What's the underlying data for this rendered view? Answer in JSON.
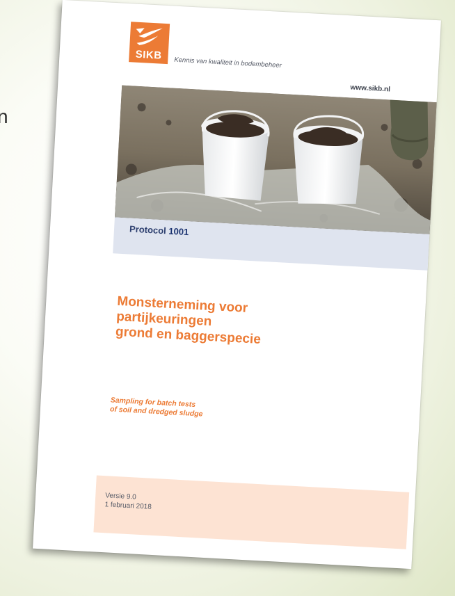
{
  "background": {
    "edge_letter": "n"
  },
  "document": {
    "logo": {
      "text": "SIKB",
      "icon": "sikb-bird-logo",
      "color": "#ec7b35"
    },
    "tagline": "Kennis van kwaliteit in bodembeheer",
    "website": "www.sikb.nl",
    "photo": {
      "icon": "soil-sample-buckets-photo"
    },
    "protocol": {
      "label": "Protocol",
      "number": "1001"
    },
    "title_lines": [
      "Monsterneming voor",
      "partijkeuringen",
      "grond en baggerspecie"
    ],
    "subtitle_lines": [
      "Sampling for batch tests",
      "of soil and dredged sludge"
    ],
    "version": "Versie 9.0",
    "date": "1 februari 2018",
    "colors": {
      "accent": "#ec7b35",
      "protocol_bar": "#dfe4ef",
      "footer_box": "#fde3d3"
    }
  }
}
